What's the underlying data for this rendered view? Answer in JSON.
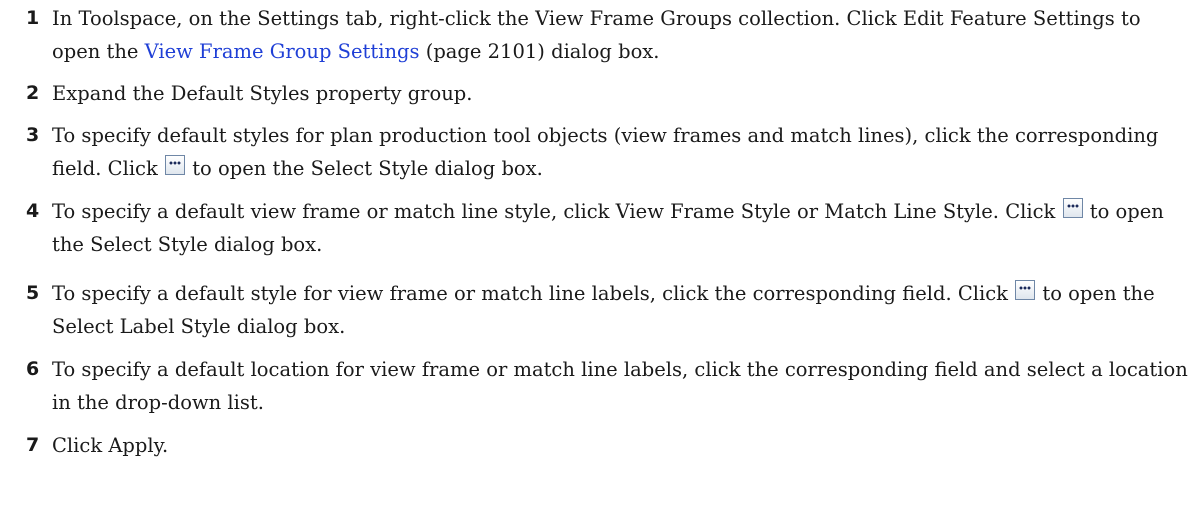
{
  "steps": [
    {
      "number": "1",
      "text_a": "In Toolspace, on the Settings tab, right-click the View Frame Groups collection. Click Edit Feature Settings to open the ",
      "link": "View Frame Group Settings",
      "text_b": " (page 2101) dialog box."
    },
    {
      "number": "2",
      "text_a": "Expand the Default Styles property group."
    },
    {
      "number": "3",
      "text_a": "To specify default styles for plan production tool objects (view frames and match lines), click the corresponding field. Click ",
      "text_b": " to open the Select Style dialog box."
    },
    {
      "number": "4",
      "text_a": "To specify a default view frame or match line style, click View Frame Style or Match Line Style. Click ",
      "text_b": " to open the Select Style dialog box."
    },
    {
      "number": "5",
      "text_a": "To specify a default style for view frame or match line labels, click the corresponding field. Click ",
      "text_b": " to open the Select Label Style dialog box."
    },
    {
      "number": "6",
      "text_a": "To specify a default location for view frame or match line labels, click the corresponding field and select a location in the drop-down list."
    },
    {
      "number": "7",
      "text_a": "Click Apply."
    }
  ],
  "icons": {
    "browse": "ellipsis-browse-button-icon"
  },
  "colors": {
    "link": "#1f3fd6",
    "text": "#1a1a1a"
  }
}
